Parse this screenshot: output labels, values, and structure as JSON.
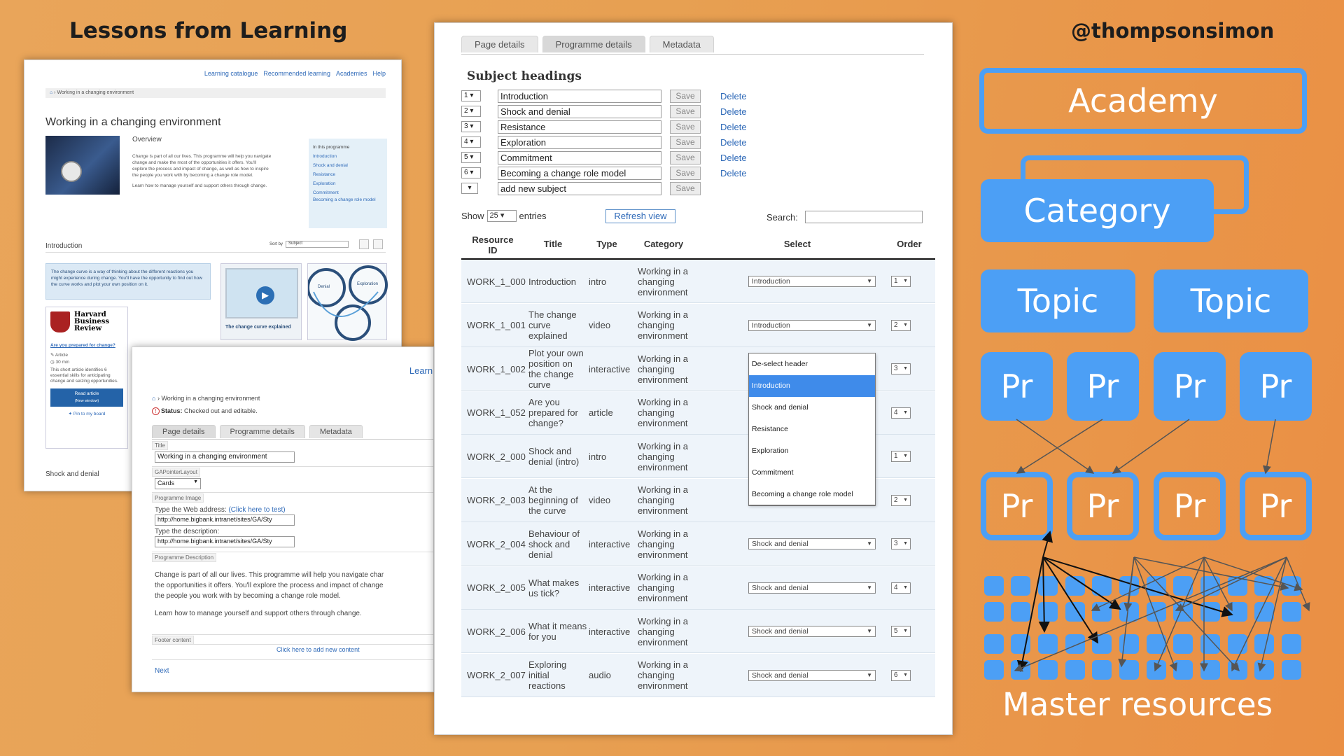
{
  "slide": {
    "left_title": "Lessons from Learning",
    "handle": "@thompsonsimon"
  },
  "catalogue_page": {
    "nav": [
      "Learning catalogue",
      "Recommended learning",
      "Academies",
      "Help"
    ],
    "breadcrumb": "Working in a changing environment",
    "title": "Working in a changing environment",
    "overview_label": "Overview",
    "overview_text": "Change is part of all our lives. This programme will help you navigate change and make the most of the opportunities it offers. You'll explore the process and impact of change, as well as how to inspire the people you work with by becoming a change role model.",
    "overview_text2": "Learn how to manage yourself and support others through change.",
    "in_programme_label": "In this programme",
    "in_programme_items": [
      "Introduction",
      "Shock and denial",
      "Resistance",
      "Exploration",
      "Commitment",
      "Becoming a change role model"
    ],
    "section_intro": "Introduction",
    "sort_label": "Sort by",
    "sort_value": "Subject",
    "card1_text": "The change curve is a way of thinking about the different reactions you might experience during change. You'll have the opportunity to find out how the curve works and plot your own position on it.",
    "card2_caption": "The change curve explained",
    "card3_labels": [
      "Denial",
      "Exploration"
    ],
    "hbr_title": "Harvard Business Review",
    "hbr_question": "Are you prepared for change?",
    "hbr_type": "Article",
    "hbr_duration": "30 min",
    "hbr_desc": "This short article identifies 6 essential skills for anticipating change and seizing opportunities.",
    "hbr_button": "Read article",
    "hbr_button_sub": "(New window)",
    "hbr_pin": "Pin to my board",
    "section_shock": "Shock and denial"
  },
  "edit_page": {
    "top_link": "Learni",
    "breadcrumb": "Working in a changing environment",
    "status_label": "Status:",
    "status_value": "Checked out and editable.",
    "tabs": [
      "Page details",
      "Programme details",
      "Metadata"
    ],
    "title_label": "Title",
    "title_value": "Working in a changing environment",
    "layout_label": "GAPointerLayout",
    "layout_value": "Cards",
    "image_label": "Programme Image",
    "web_address_label": "Type the Web address:",
    "web_address_link": "(Click here to test)",
    "web_address_value": "http://home.bigbank.intranet/sites/GA/Sty",
    "description_label": "Type the description:",
    "description_value": "http://home.bigbank.intranet/sites/GA/Sty",
    "prog_desc_label": "Programme Description",
    "prog_desc_lines": [
      "Change is part of all our lives. This programme will help you navigate char",
      "the opportunities it offers. You'll explore the process and impact of change",
      "the people you work with by becoming a change role model."
    ],
    "prog_desc_line2": "Learn how to manage yourself and support others through change.",
    "footer_label": "Footer content",
    "add_new": "Click here to add new content",
    "next": "Next"
  },
  "programme_details": {
    "tabs": [
      "Page details",
      "Programme details",
      "Metadata"
    ],
    "subject_heading": "Subject headings",
    "save_label": "Save",
    "delete_label": "Delete",
    "subjects": [
      {
        "num": "1",
        "text": "Introduction"
      },
      {
        "num": "2",
        "text": "Shock and denial"
      },
      {
        "num": "3",
        "text": "Resistance"
      },
      {
        "num": "4",
        "text": "Exploration"
      },
      {
        "num": "5",
        "text": "Commitment"
      },
      {
        "num": "6",
        "text": "Becoming a change role model"
      },
      {
        "num": "",
        "text": "add new subject"
      }
    ],
    "show_label": "Show",
    "show_value": "25",
    "entries_label": "entries",
    "refresh_label": "Refresh view",
    "search_label": "Search:",
    "columns": [
      "Resource ID",
      "Title",
      "Type",
      "Category",
      "Select",
      "Order"
    ],
    "rows": [
      {
        "id": "WORK_1_000",
        "title": "Introduction",
        "type": "intro",
        "category": "Working in a changing environment",
        "select": "Introduction",
        "order": "1"
      },
      {
        "id": "WORK_1_001",
        "title": "The change curve explained",
        "type": "video",
        "category": "Working in a changing environment",
        "select": "Introduction",
        "order": "2"
      },
      {
        "id": "WORK_1_002",
        "title": "Plot your own position on the change curve",
        "type": "interactive",
        "category": "Working in a changing environment",
        "select": "",
        "order": "3"
      },
      {
        "id": "WORK_1_052",
        "title": "Are you prepared for change?",
        "type": "article",
        "category": "Working in a changing environment",
        "select": "",
        "order": "4"
      },
      {
        "id": "WORK_2_000",
        "title": "Shock and denial (intro)",
        "type": "intro",
        "category": "Working in a changing environment",
        "select": "",
        "order": "1"
      },
      {
        "id": "WORK_2_003",
        "title": "At the beginning of the curve",
        "type": "video",
        "category": "Working in a changing environment",
        "select": "Shock and denial",
        "order": "2"
      },
      {
        "id": "WORK_2_004",
        "title": "Behaviour of shock and denial",
        "type": "interactive",
        "category": "Working in a changing environment",
        "select": "Shock and denial",
        "order": "3"
      },
      {
        "id": "WORK_2_005",
        "title": "What makes us tick?",
        "type": "interactive",
        "category": "Working in a changing environment",
        "select": "Shock and denial",
        "order": "4"
      },
      {
        "id": "WORK_2_006",
        "title": "What it means for you",
        "type": "interactive",
        "category": "Working in a changing environment",
        "select": "Shock and denial",
        "order": "5"
      },
      {
        "id": "WORK_2_007",
        "title": "Exploring initial reactions",
        "type": "audio",
        "category": "Working in a changing environment",
        "select": "Shock and denial",
        "order": "6"
      }
    ],
    "dropdown_options": [
      "De-select header",
      "Introduction",
      "Shock and denial",
      "Resistance",
      "Exploration",
      "Commitment",
      "Becoming a change role model"
    ],
    "dropdown_selected": "Introduction"
  },
  "diagram": {
    "academy": "Academy",
    "category": "Category",
    "topic": "Topic",
    "pr": "Pr",
    "master": "Master resources",
    "accent": "#4c9ff5"
  }
}
